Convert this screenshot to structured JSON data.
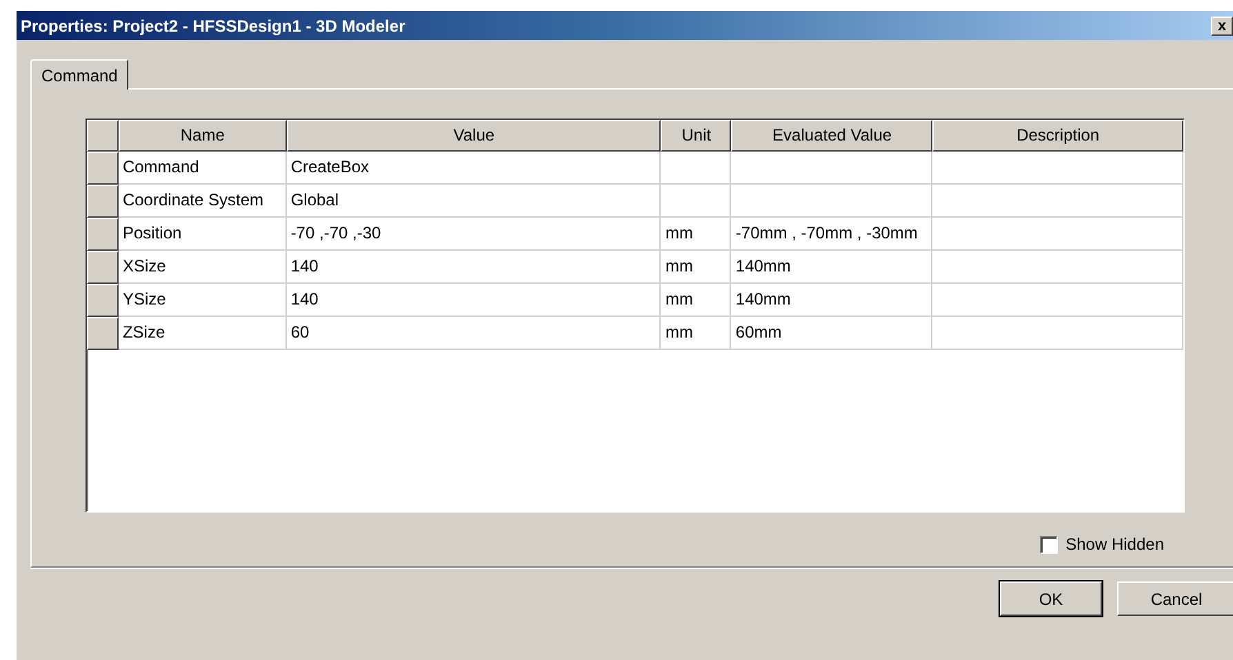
{
  "window": {
    "title": "Properties: Project2 - HFSSDesign1 - 3D Modeler",
    "close": "x"
  },
  "tabs": [
    {
      "label": "Command",
      "selected": true
    }
  ],
  "table": {
    "columns": [
      "Name",
      "Value",
      "Unit",
      "Evaluated Value",
      "Description"
    ],
    "rows": [
      {
        "name": "Command",
        "value": "CreateBox",
        "unit": "",
        "evaluated": "",
        "description": ""
      },
      {
        "name": "Coordinate System",
        "value": "Global",
        "unit": "",
        "evaluated": "",
        "description": ""
      },
      {
        "name": "Position",
        "value": "-70 ,-70 ,-30",
        "unit": "mm",
        "evaluated": "-70mm , -70mm , -30mm",
        "description": ""
      },
      {
        "name": "XSize",
        "value": "140",
        "unit": "mm",
        "evaluated": "140mm",
        "description": ""
      },
      {
        "name": "YSize",
        "value": "140",
        "unit": "mm",
        "evaluated": "140mm",
        "description": ""
      },
      {
        "name": "ZSize",
        "value": "60",
        "unit": "mm",
        "evaluated": "60mm",
        "description": ""
      }
    ]
  },
  "show_hidden": {
    "label": "Show Hidden",
    "checked": false
  },
  "buttons": [
    "OK",
    "Cancel"
  ]
}
